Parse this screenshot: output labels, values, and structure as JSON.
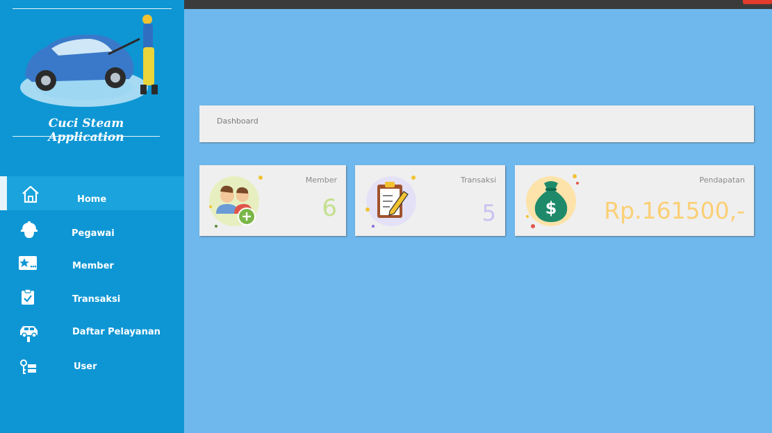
{
  "app": {
    "title": "Cuci Steam Application"
  },
  "sidebar": {
    "items": [
      {
        "label": "Home",
        "icon": "home-icon",
        "active": true
      },
      {
        "label": "Pegawai",
        "icon": "worker-helmet-icon",
        "active": false
      },
      {
        "label": "Member",
        "icon": "member-card-icon",
        "active": false
      },
      {
        "label": "Transaksi",
        "icon": "clipboard-check-icon",
        "active": false
      },
      {
        "label": "Daftar Pelayanan",
        "icon": "car-service-icon",
        "active": false
      },
      {
        "label": "User",
        "icon": "user-key-icon",
        "active": false
      }
    ]
  },
  "main": {
    "header": "Dashboard",
    "cards": [
      {
        "title": "Member",
        "value": "6",
        "color": "#c3e08f",
        "icon": "members-add-icon"
      },
      {
        "title": "Transaksi",
        "value": "5",
        "color": "#c7c2ef",
        "icon": "clipboard-pencil-icon"
      },
      {
        "title": "Pendapatan",
        "value": "Rp.161500,-",
        "color": "#fbcf74",
        "icon": "money-bag-icon"
      }
    ]
  },
  "colors": {
    "sidebar": "#0e96d4",
    "content_bg": "#6fb8ed",
    "topbar": "#3b3b3b",
    "close": "#e23b2c"
  }
}
